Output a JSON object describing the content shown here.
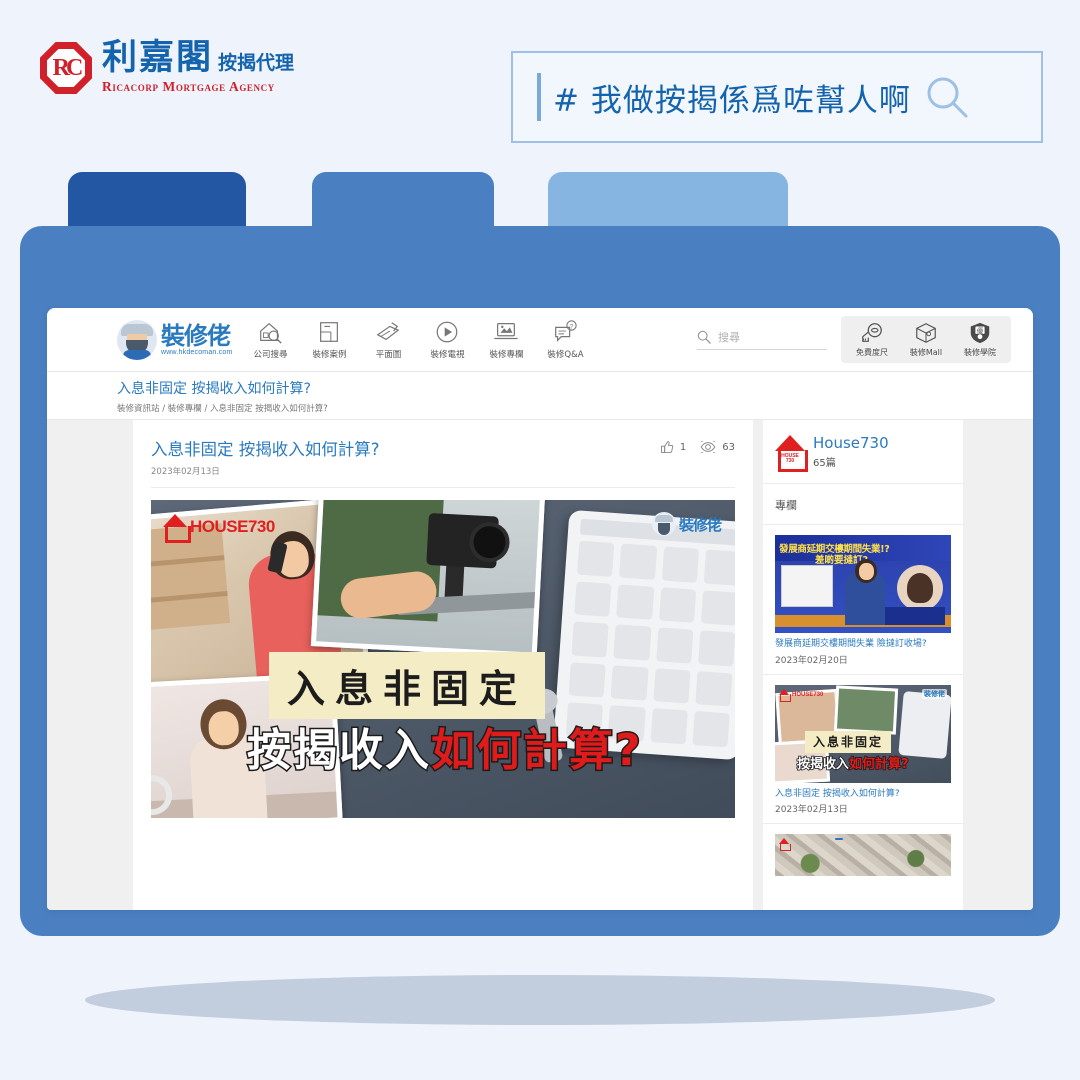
{
  "brand": {
    "logo_mark": "rc-octagon-logo",
    "chinese_name": "利嘉閣",
    "chinese_sub": "按揭代理",
    "english_name": "Ricacorp Mortgage Agency"
  },
  "hashtag_banner": {
    "text": "# 我做按揭係爲咗幫人啊",
    "search_icon": "search-icon"
  },
  "folder": {
    "tabs": [
      {
        "color": "#2356a3"
      },
      {
        "color": "#4a7fc1"
      },
      {
        "color": "#85b5e0"
      }
    ],
    "body_color": "#4a7fc1"
  },
  "site": {
    "logo": {
      "name": "裝修佬",
      "url": "www.hkdecoman.com"
    },
    "nav": [
      {
        "label": "公司搜尋",
        "icon": "house-search-icon"
      },
      {
        "label": "裝修案例",
        "icon": "floorplan-icon"
      },
      {
        "label": "平面圖",
        "icon": "pencil-sketch-icon"
      },
      {
        "label": "裝修電視",
        "icon": "play-circle-icon"
      },
      {
        "label": "裝修專欄",
        "icon": "laptop-image-icon"
      },
      {
        "label": "裝修Q&A",
        "icon": "chat-question-icon"
      }
    ],
    "search": {
      "placeholder": "搜尋",
      "icon": "search-icon"
    },
    "utilities": [
      {
        "label": "免費度尺",
        "icon": "tape-measure-icon"
      },
      {
        "label": "裝修Mall",
        "icon": "package-box-icon"
      },
      {
        "label": "裝修學院",
        "icon": "shield-badge-icon"
      }
    ]
  },
  "page": {
    "title": "入息非固定 按揭收入如何計算?",
    "breadcrumb": "裝修資訊站 / 裝修專欄 / 入息非固定 按揭收入如何計算?"
  },
  "article": {
    "title": "入息非固定 按揭收入如何計算?",
    "date": "2023年02月13日",
    "likes": "1",
    "views": "63",
    "like_icon": "thumbs-up-icon",
    "view_icon": "eye-icon",
    "hero": {
      "brand_left": "HOUSE730",
      "brand_right": "裝修佬",
      "caption_top": "入息非固定",
      "caption_bottom_white": "按揭收入",
      "caption_bottom_red": "如何計算?"
    }
  },
  "sidebar": {
    "author": {
      "name": "House730",
      "post_count": "65篇",
      "logo": "house730-logo"
    },
    "section_label": "專欄",
    "cards": [
      {
        "title": "發展商延期交樓期間失業 險撻訂收場?",
        "date": "2023年02月20日",
        "thumb_headline": "發展商延期交樓期間失業!?",
        "thumb_subline": "差啲要撻訂?"
      },
      {
        "title": "入息非固定 按揭收入如何計算?",
        "date": "2023年02月13日",
        "thumb_headline": "入息非固定",
        "thumb_subline_white": "按揭收入",
        "thumb_subline_red": "如何計算?"
      },
      {
        "title": "",
        "date": "",
        "thumb_headline": ""
      }
    ]
  }
}
